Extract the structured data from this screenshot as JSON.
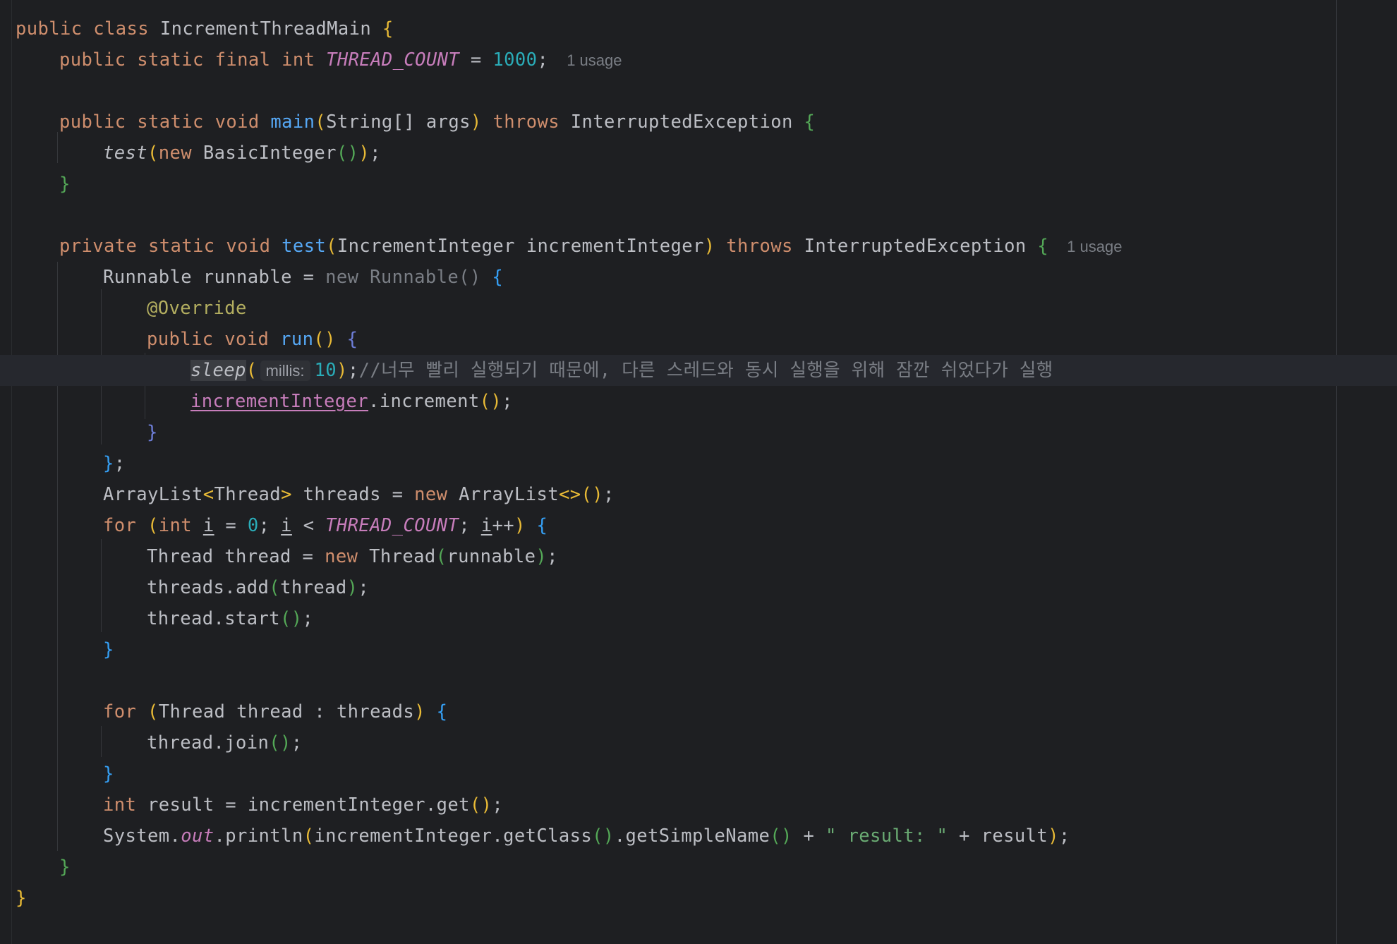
{
  "editor": {
    "language": "Java",
    "class_name": "IncrementThreadMain",
    "inlay_hints": {
      "usage_1": "1 usage",
      "usage_2": "1 usage",
      "param_millis": "millis:"
    },
    "comment_text": "//너무 빨리 실행되기 때문에, 다른 스레드와 동시 실행을 위해 잠깐 쉬었다가 실행",
    "string_literal": "\" result: \"",
    "numbers": {
      "thread_count": "1000",
      "sleep_millis": "10",
      "loop_start": "0"
    },
    "tokens": {
      "public": "public",
      "class": "class",
      "static": "static",
      "final": "final",
      "int": "int",
      "void": "void",
      "private": "private",
      "throws": "throws",
      "new": "new",
      "for": "for",
      "thread_count_const": "THREAD_COUNT",
      "main": "main",
      "test": "test",
      "run": "run",
      "sleep": "sleep",
      "string_arr": "String[] args",
      "interrupted": "InterruptedException",
      "basic_integer": "BasicInteger",
      "increment_integer_type": "IncrementInteger",
      "increment_integer_var": "incrementInteger",
      "runnable_type": "Runnable",
      "runnable_var": "runnable",
      "anon_new": "new Runnable()",
      "override": "@Override",
      "increment_call": ".increment",
      "arraylist": "ArrayList",
      "thread_type": "Thread",
      "threads": "threads",
      "thread_var": "thread",
      "i": "i",
      "add": ".add",
      "start": ".start",
      "join": ".join",
      "result": "result",
      "get": ".get",
      "system": "System.",
      "out": "out",
      "println": ".println",
      "get_class": ".getClass",
      "get_simple_name": ".getSimpleName"
    }
  },
  "colors": {
    "background": "#1e1f22",
    "keyword": "#cf8e6d",
    "function": "#56a8f5",
    "number": "#2aacb8",
    "constant": "#c77dbb",
    "string": "#6aab73",
    "comment": "#7a7e85",
    "annotation": "#b3ae60"
  }
}
